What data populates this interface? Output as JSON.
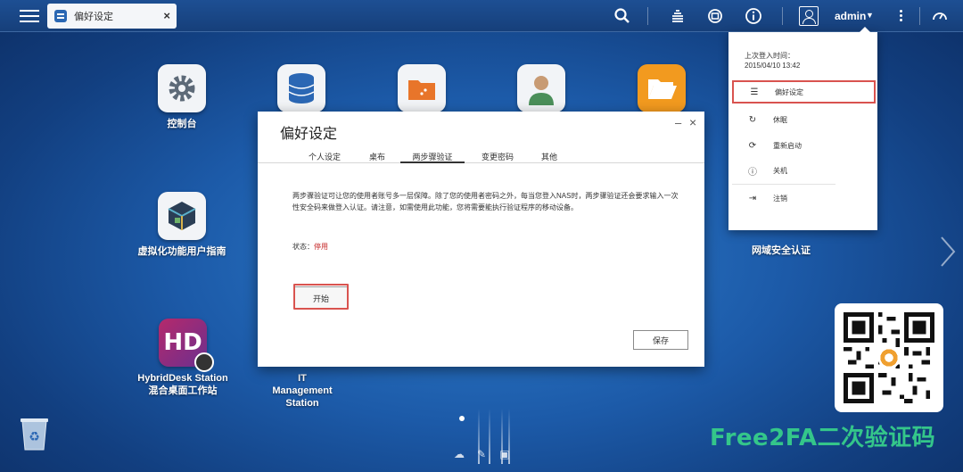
{
  "tab": {
    "title": "偏好设定"
  },
  "topbar": {
    "user": "admin"
  },
  "desktop": {
    "apps": [
      {
        "label": "控制台"
      },
      {
        "label": "虚拟化功能用户指南"
      },
      {
        "label": "HybridDesk Station 混合桌面工作站"
      },
      {
        "label": "IT Management Station"
      },
      {
        "label": "网域安全认证"
      }
    ]
  },
  "dialog": {
    "title": "偏好设定",
    "tabs": [
      "个人设定",
      "桌布",
      "两步骤验证",
      "变更密码",
      "其他"
    ],
    "active_tab": "两步骤验证",
    "description": "两步骤验证可让您的使用者账号多一层保障。除了您的使用者密码之外，每当您登入NAS时，两步骤验证还会要求输入一次性安全码来做登入认证。请注意，如需使用此功能，您将需要能执行验证程序的移动设备。",
    "status_label": "状态：",
    "status_value": "停用",
    "start_label": "开始",
    "save_label": "保存"
  },
  "menu": {
    "last_login_label": "上次登入时间：",
    "last_login_value": "2015/04/10 13:42",
    "items": [
      "偏好设定",
      "休眠",
      "重新启动",
      "关机",
      "注销"
    ]
  },
  "watermark": "Free2FA二次验证码",
  "colors": {
    "highlight": "#d9534f",
    "status_off": "#c62828",
    "watermark": "#34c68a",
    "topbar": "#1d4f93"
  }
}
